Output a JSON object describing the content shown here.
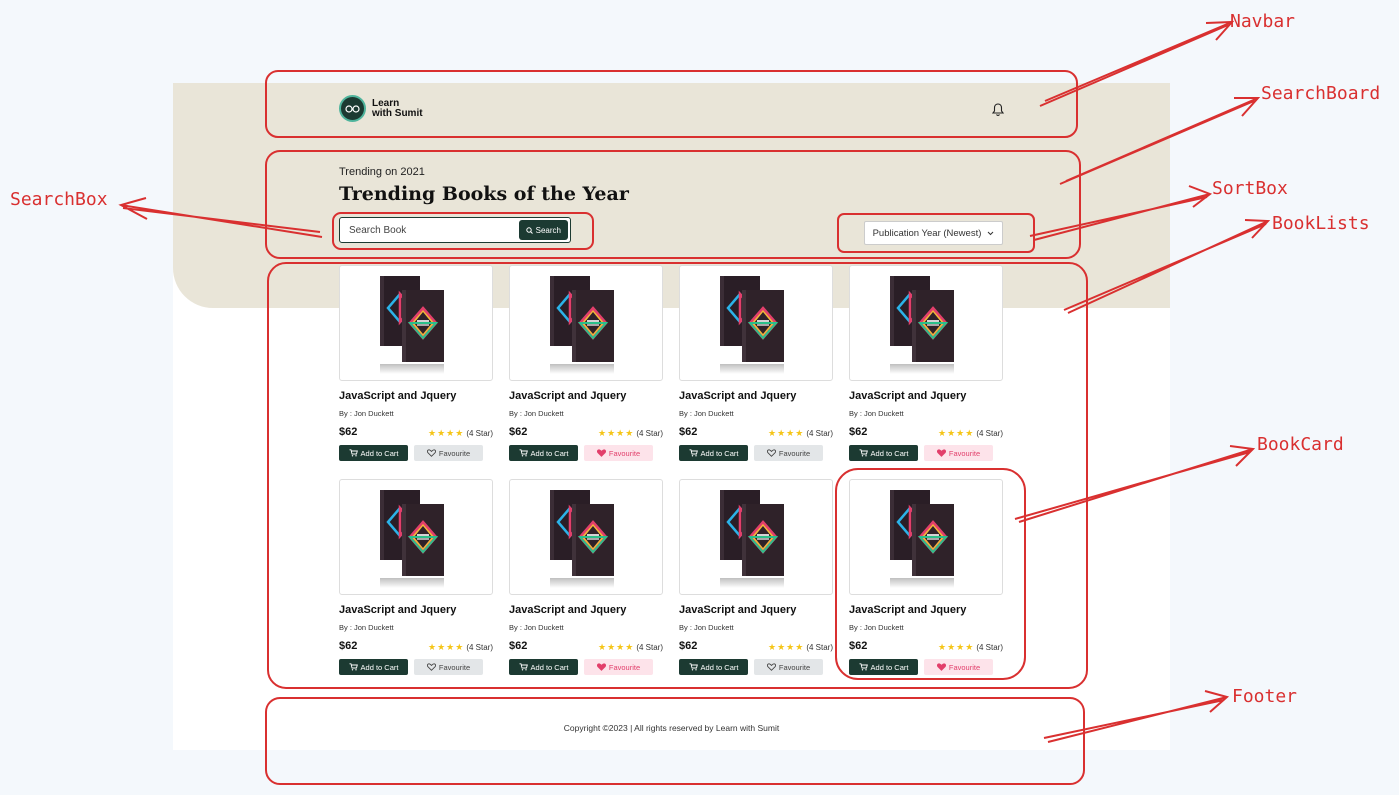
{
  "navbar": {
    "logo_line1": "Learn",
    "logo_line2": "with Sumit",
    "logo_icon": "glasses-logo-icon",
    "bell_icon": "bell-icon"
  },
  "search_board": {
    "subtitle": "Trending on 2021",
    "title": "Trending Books of the Year",
    "search_placeholder": "Search Book",
    "search_button": "Search"
  },
  "sort": {
    "selected": "Publication Year (Newest)"
  },
  "books": [
    {
      "title": "JavaScript and Jquery",
      "author": "By : Jon Duckett",
      "price": "$62",
      "rating": 4,
      "rating_label": "(4 Star)",
      "cart_label": "Add to Cart",
      "fav_label": "Favourite",
      "favourited": false
    },
    {
      "title": "JavaScript and Jquery",
      "author": "By : Jon Duckett",
      "price": "$62",
      "rating": 4,
      "rating_label": "(4 Star)",
      "cart_label": "Add to Cart",
      "fav_label": "Favourite",
      "favourited": true
    },
    {
      "title": "JavaScript and Jquery",
      "author": "By : Jon Duckett",
      "price": "$62",
      "rating": 4,
      "rating_label": "(4 Star)",
      "cart_label": "Add to Cart",
      "fav_label": "Favourite",
      "favourited": false
    },
    {
      "title": "JavaScript and Jquery",
      "author": "By : Jon Duckett",
      "price": "$62",
      "rating": 4,
      "rating_label": "(4 Star)",
      "cart_label": "Add to Cart",
      "fav_label": "Favourite",
      "favourited": true
    },
    {
      "title": "JavaScript and Jquery",
      "author": "By : Jon Duckett",
      "price": "$62",
      "rating": 4,
      "rating_label": "(4 Star)",
      "cart_label": "Add to Cart",
      "fav_label": "Favourite",
      "favourited": false
    },
    {
      "title": "JavaScript and Jquery",
      "author": "By : Jon Duckett",
      "price": "$62",
      "rating": 4,
      "rating_label": "(4 Star)",
      "cart_label": "Add to Cart",
      "fav_label": "Favourite",
      "favourited": true
    },
    {
      "title": "JavaScript and Jquery",
      "author": "By : Jon Duckett",
      "price": "$62",
      "rating": 4,
      "rating_label": "(4 Star)",
      "cart_label": "Add to Cart",
      "fav_label": "Favourite",
      "favourited": false
    },
    {
      "title": "JavaScript and Jquery",
      "author": "By : Jon Duckett",
      "price": "$62",
      "rating": 4,
      "rating_label": "(4 Star)",
      "cart_label": "Add to Cart",
      "fav_label": "Favourite",
      "favourited": true
    }
  ],
  "footer": {
    "text": "Copyright ©2023 | All rights reserved by Learn with Sumit"
  },
  "annotations": {
    "navbar": "Navbar",
    "search_board": "SearchBoard",
    "search_box": "SearchBox",
    "sort_box": "SortBox",
    "book_lists": "BookLists",
    "book_card": "BookCard",
    "footer": "Footer"
  },
  "colors": {
    "primary": "#1c3a32",
    "hero_bg": "#e9e5d8",
    "annotation": "#d93030",
    "star": "#f5c518",
    "fav_active": "#e23f6b"
  }
}
